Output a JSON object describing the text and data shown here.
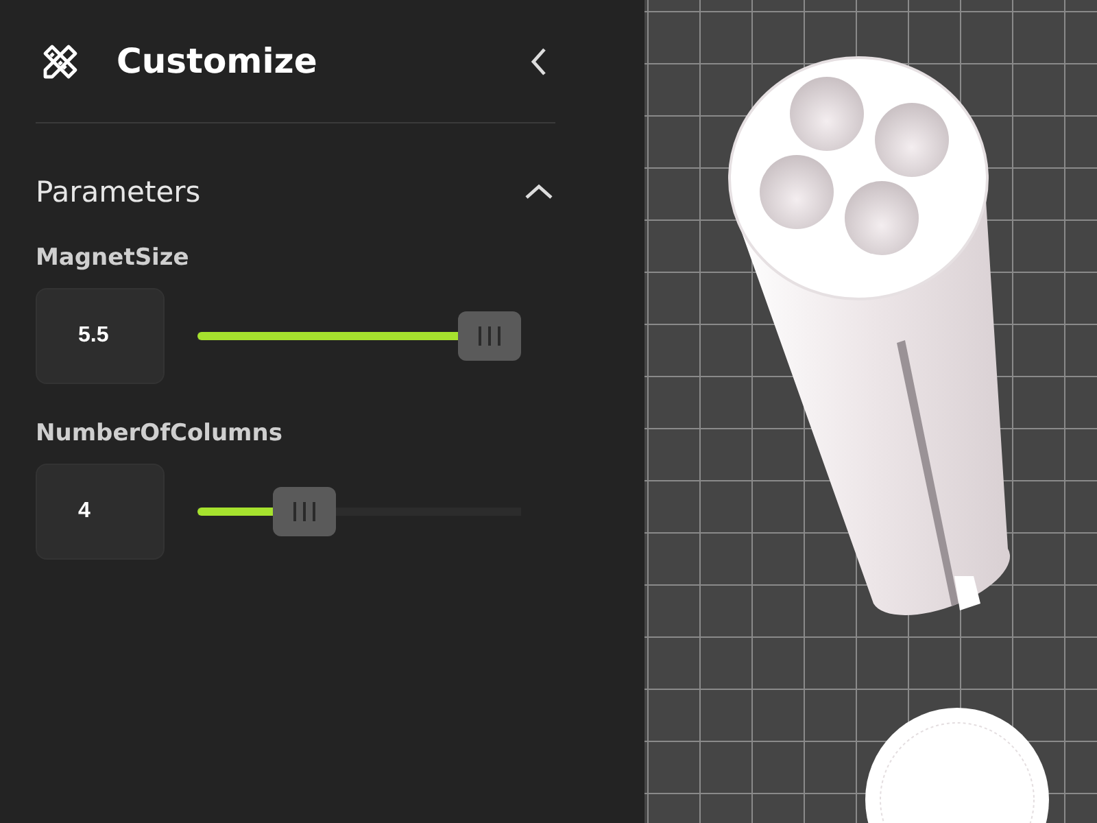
{
  "panel": {
    "title": "Customize"
  },
  "section": {
    "title": "Parameters",
    "expanded": true
  },
  "parameters": [
    {
      "label": "MagnetSize",
      "value": "5.5",
      "level": 1.0
    },
    {
      "label": "NumberOfColumns",
      "value": "4",
      "level": 0.29
    }
  ]
}
